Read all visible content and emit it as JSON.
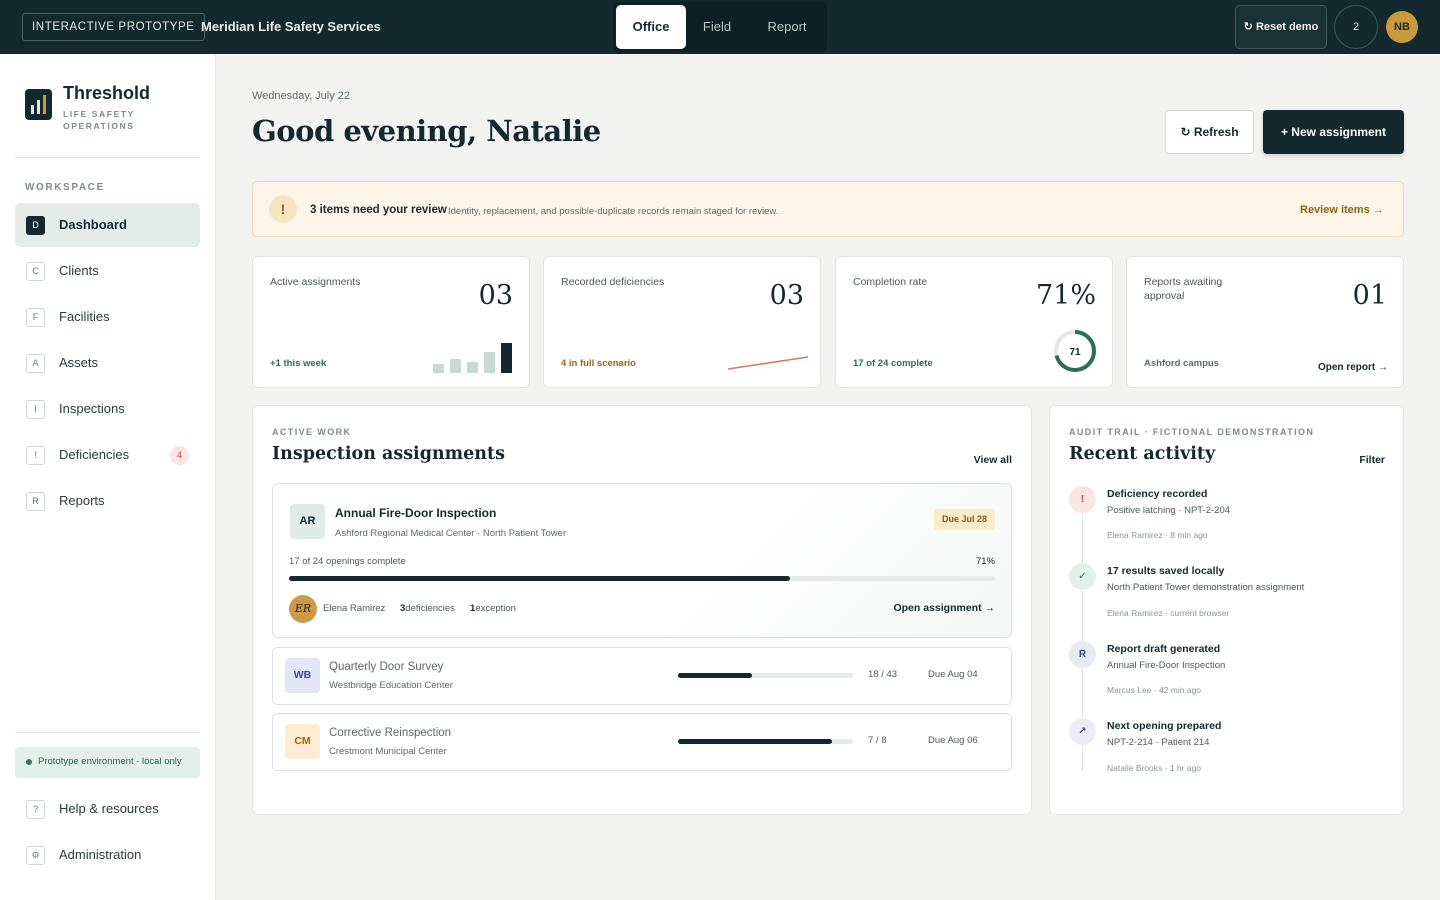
{
  "topbar": {
    "badge": "INTERACTIVE PROTOTYPE",
    "org": "Meridian Life Safety Services",
    "modes": [
      "Office",
      "Field",
      "Report"
    ],
    "active_mode": "Office",
    "reset_label": "↻ Reset demo",
    "notification_count": "2",
    "user_initials": "NB"
  },
  "sidebar": {
    "brand_title": "Threshold",
    "brand_subtitle": "LIFE SAFETY OPERATIONS",
    "section_label": "WORKSPACE",
    "items": [
      {
        "letter": "D",
        "label": "Dashboard",
        "active": true
      },
      {
        "letter": "C",
        "label": "Clients"
      },
      {
        "letter": "F",
        "label": "Facilities"
      },
      {
        "letter": "A",
        "label": "Assets"
      },
      {
        "letter": "I",
        "label": "Inspections"
      },
      {
        "letter": "!",
        "label": "Deficiencies",
        "badge": "4"
      },
      {
        "letter": "R",
        "label": "Reports"
      }
    ],
    "env_note": "Prototype environment · local only",
    "footer_items": [
      {
        "letter": "?",
        "label": "Help & resources"
      },
      {
        "letter": "⚙",
        "label": "Administration"
      }
    ]
  },
  "header": {
    "date": "Wednesday, July 22",
    "greeting": "Good evening, Natalie",
    "refresh_label": "↻ Refresh",
    "new_label": "+ New assignment"
  },
  "alert": {
    "icon": "!",
    "title": "3 items need your review",
    "description": "Identity, replacement, and possible-duplicate records remain staged for review.",
    "link": "Review items →"
  },
  "stats": [
    {
      "label": "Active assignments",
      "value": "03",
      "foot": "+1 this week",
      "foot_color": "#2d6e52",
      "bars": [
        0.3,
        0.45,
        0.35,
        0.7,
        1.0
      ]
    },
    {
      "label": "Recorded deficiencies",
      "value": "03",
      "foot": "4 in full scenario",
      "foot_color": "#9a6512"
    },
    {
      "label": "Completion rate",
      "value": "71%",
      "foot": "17 of 24 complete",
      "foot_color": "#2d6e52",
      "ring_value": "71",
      "ring_fraction": 0.71
    },
    {
      "label": "Reports awaiting approval",
      "value": "01",
      "foot": "Ashford campus",
      "foot_color": "#5c6a69",
      "link": "Open report →"
    }
  ],
  "assignments": {
    "kicker": "ACTIVE WORK",
    "title": "Inspection assignments",
    "view_all": "View all",
    "featured": {
      "mono": "AR",
      "title": "Annual Fire-Door Inspection",
      "subtitle": "Ashford Regional Medical Center · North Patient Tower",
      "due": "Due Jul 28",
      "progress_text": "17 of 24 openings complete",
      "progress_pct": "71%",
      "progress": 0.71,
      "inspector_initials": "ER",
      "inspector": "Elena Ramirez",
      "deficiencies_count": "3",
      "deficiencies_label": "deficiencies",
      "exceptions_count": "1",
      "exceptions_label": "exception",
      "open_label": "Open assignment →"
    },
    "rows": [
      {
        "mono": "WB",
        "title": "Quarterly Door Survey",
        "subtitle": "Westbridge Education Center",
        "count": "18 / 43",
        "due": "Due Aug 04",
        "progress": 0.42,
        "mono_bg": "#e3e6f6",
        "mono_color": "#3b4a86"
      },
      {
        "mono": "CM",
        "title": "Corrective Reinspection",
        "subtitle": "Crestmont Municipal Center",
        "count": "7 / 8",
        "due": "Due Aug 06",
        "progress": 0.88,
        "mono_bg": "#fbecd2",
        "mono_color": "#9a6512"
      }
    ]
  },
  "activity": {
    "kicker": "AUDIT TRAIL · FICTIONAL DEMONSTRATION",
    "title": "Recent activity",
    "filter": "Filter",
    "items": [
      {
        "icon": "!",
        "title": "Deficiency recorded",
        "subtitle": "Positive latching · NPT-2-204",
        "meta": "Elena Ramirez · 8 min ago",
        "bg": "#fbe5e3",
        "color": "#c0463f"
      },
      {
        "icon": "✓",
        "title": "17 results saved locally",
        "subtitle": "North Patient Tower demonstration assignment",
        "meta": "Elena Ramirez · current browser",
        "bg": "#e3f0ea",
        "color": "#2d6e52"
      },
      {
        "icon": "R",
        "title": "Report draft generated",
        "subtitle": "Annual Fire-Door Inspection",
        "meta": "Marcus Lee · 42 min ago",
        "bg": "#e6ebf2",
        "color": "#3b4a6b"
      },
      {
        "icon": "↗",
        "title": "Next opening prepared",
        "subtitle": "NPT-2-214 · Patient 214",
        "meta": "Natalie Brooks · 1 hr ago",
        "bg": "#ecebf6",
        "color": "#4a4a86"
      }
    ]
  }
}
